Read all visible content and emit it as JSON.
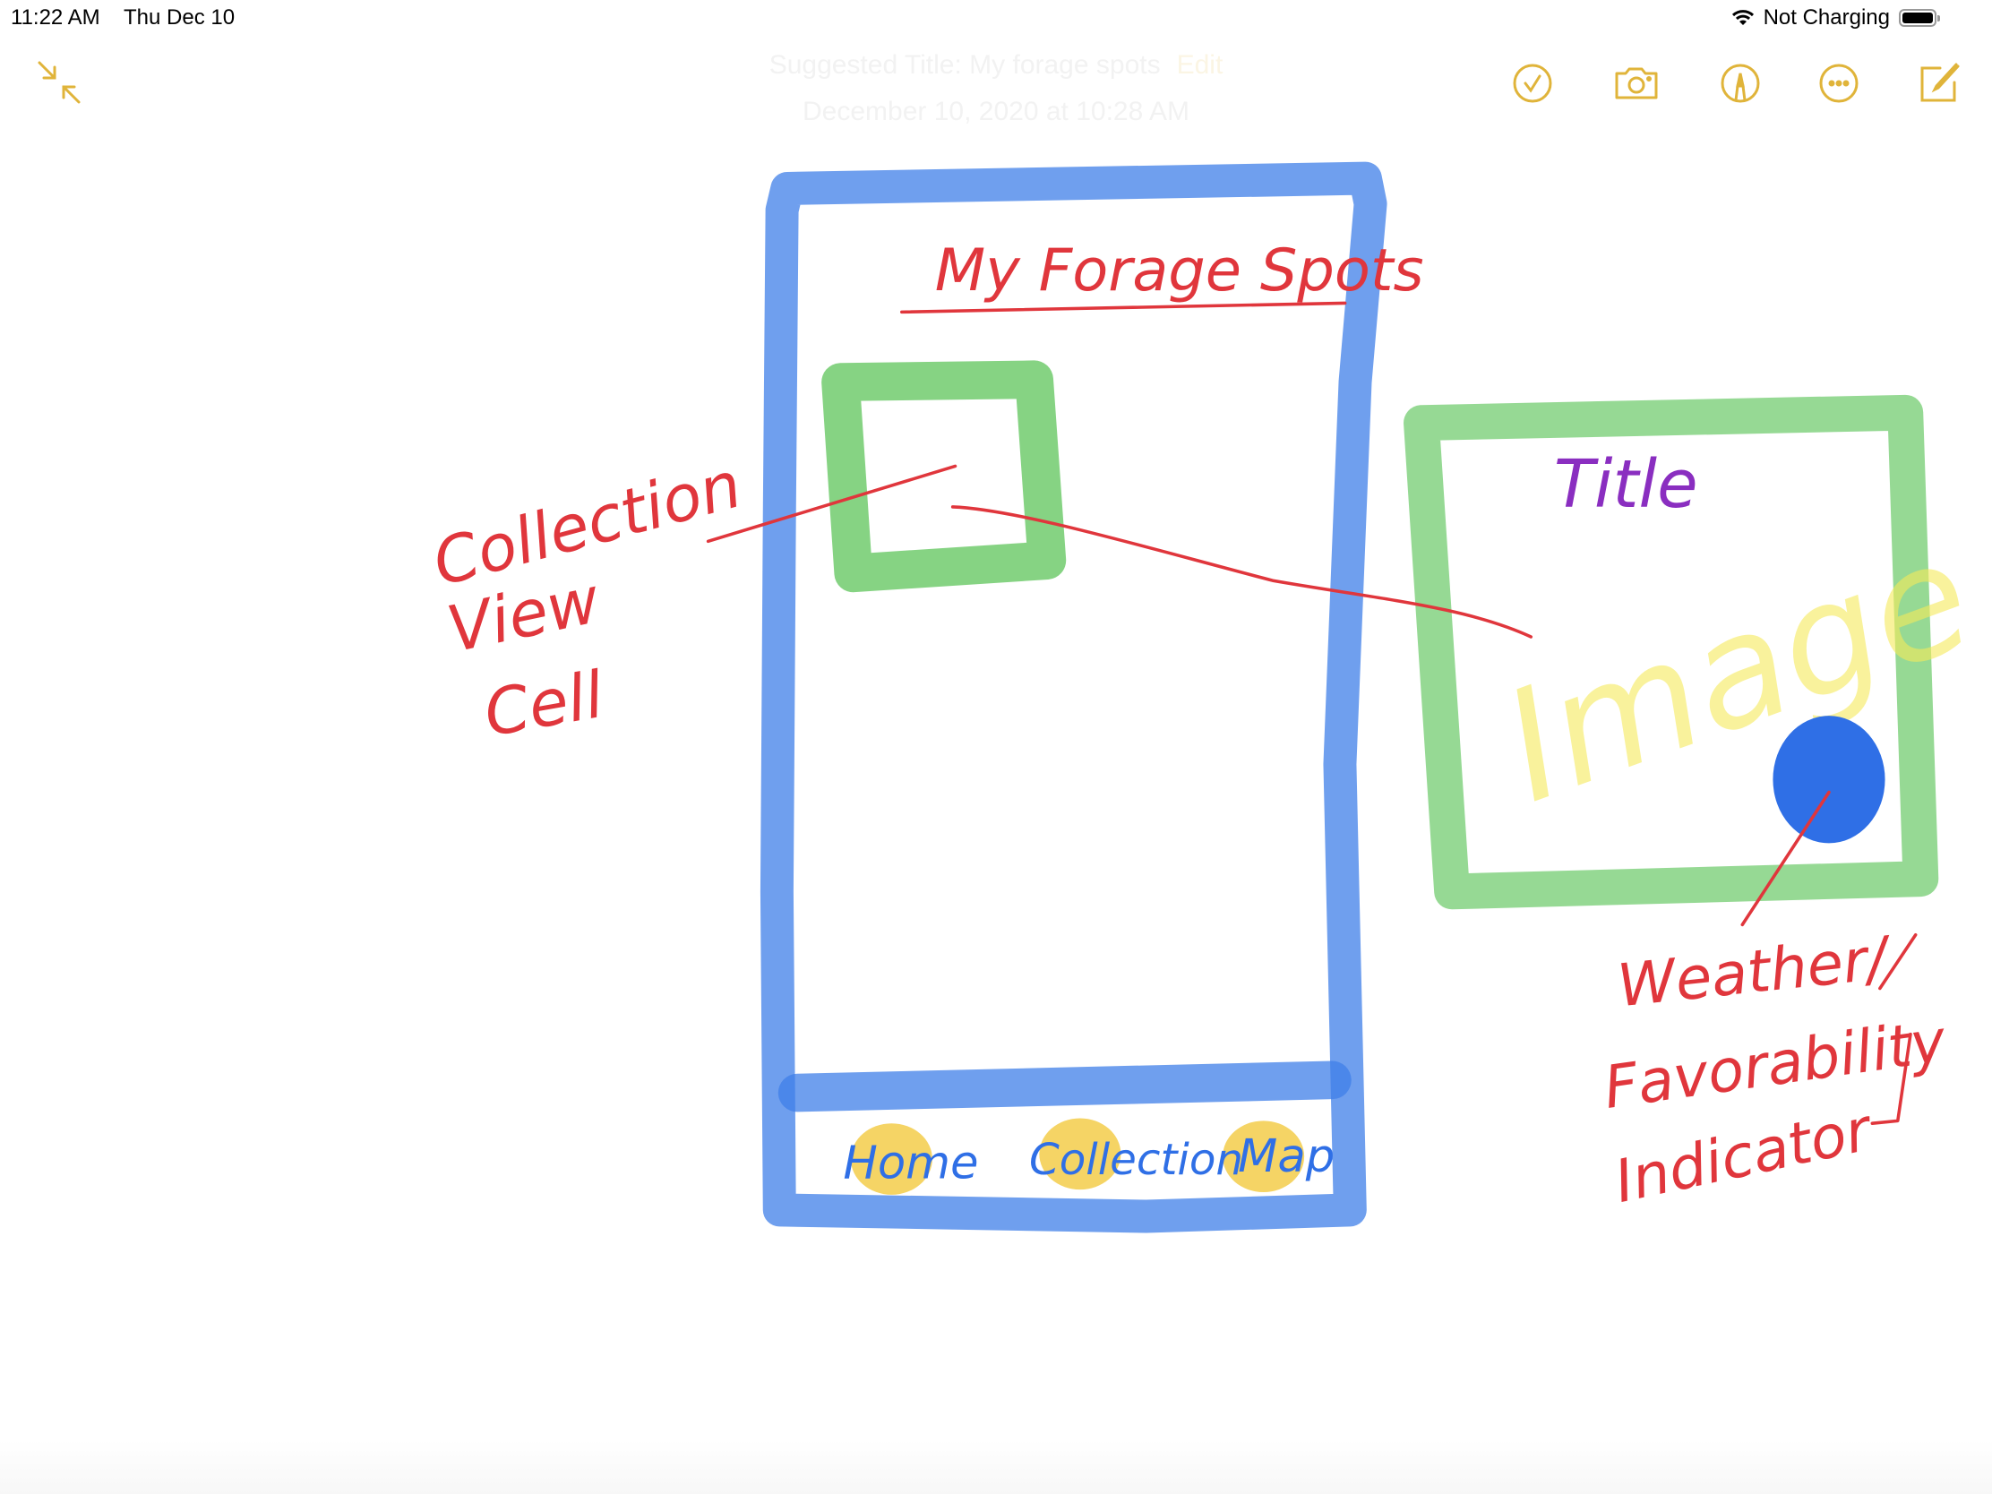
{
  "status_bar": {
    "time": "11:22 AM",
    "date": "Thu Dec 10",
    "battery_status": "Not Charging",
    "battery_level": 100
  },
  "note_header": {
    "suggested_title": "Suggested Title: My forage spots",
    "edit_label": "Edit",
    "created": "December 10, 2020 at 10:28 AM"
  },
  "toolbar": {
    "accent": "#e0b43a",
    "left": {
      "icon": "collapse-icon"
    },
    "right": [
      {
        "icon": "checklist-icon"
      },
      {
        "icon": "camera-icon"
      },
      {
        "icon": "markup-pen-icon"
      },
      {
        "icon": "more-icon"
      },
      {
        "icon": "compose-icon"
      }
    ]
  },
  "sketch": {
    "colors": {
      "phone": "#3f7fe8",
      "cell": "#5ec45a",
      "annotation": "#e0363c",
      "title": "#8a2ec0",
      "image": "#f5ea5a",
      "tabs": "#f2c531",
      "indicator": "#2f6fe6"
    },
    "screen_title": "My Forage Spots",
    "tabs": [
      "Home",
      "Collection",
      "Map"
    ],
    "cell_label": [
      "Collection",
      "View",
      "Cell"
    ],
    "detail_title": "Title",
    "detail_image": "Image",
    "indicator_label": [
      "Weather/",
      "Favorability",
      "Indicator"
    ]
  }
}
